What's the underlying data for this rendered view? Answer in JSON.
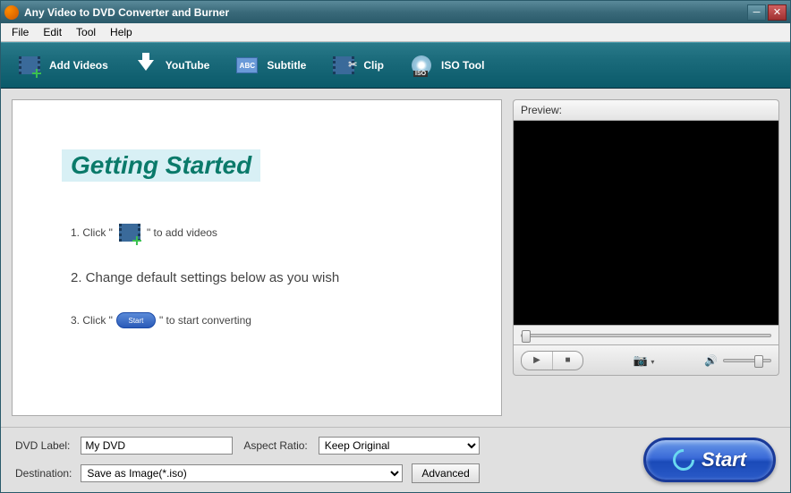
{
  "titlebar": {
    "title": "Any Video to DVD Converter and Burner"
  },
  "menubar": {
    "items": [
      "File",
      "Edit",
      "Tool",
      "Help"
    ]
  },
  "toolbar": {
    "add_videos": "Add Videos",
    "youtube": "YouTube",
    "subtitle": "Subtitle",
    "subtitle_abc": "ABC",
    "clip": "Clip",
    "iso_tool": "ISO Tool"
  },
  "getting_started": {
    "title": "Getting Started",
    "step1_a": "1. Click \"",
    "step1_b": "\" to add videos",
    "step2": "2. Change default settings below as you wish",
    "step3_a": "3. Click \"",
    "step3_pill": "Start",
    "step3_b": "\" to start  converting"
  },
  "preview": {
    "label": "Preview:"
  },
  "bottom": {
    "dvd_label": "DVD Label:",
    "dvd_label_value": "My DVD",
    "aspect_ratio": "Aspect Ratio:",
    "aspect_ratio_value": "Keep Original",
    "destination": "Destination:",
    "destination_value": "Save as Image(*.iso)",
    "advanced": "Advanced"
  },
  "start_button": {
    "label": "Start"
  }
}
